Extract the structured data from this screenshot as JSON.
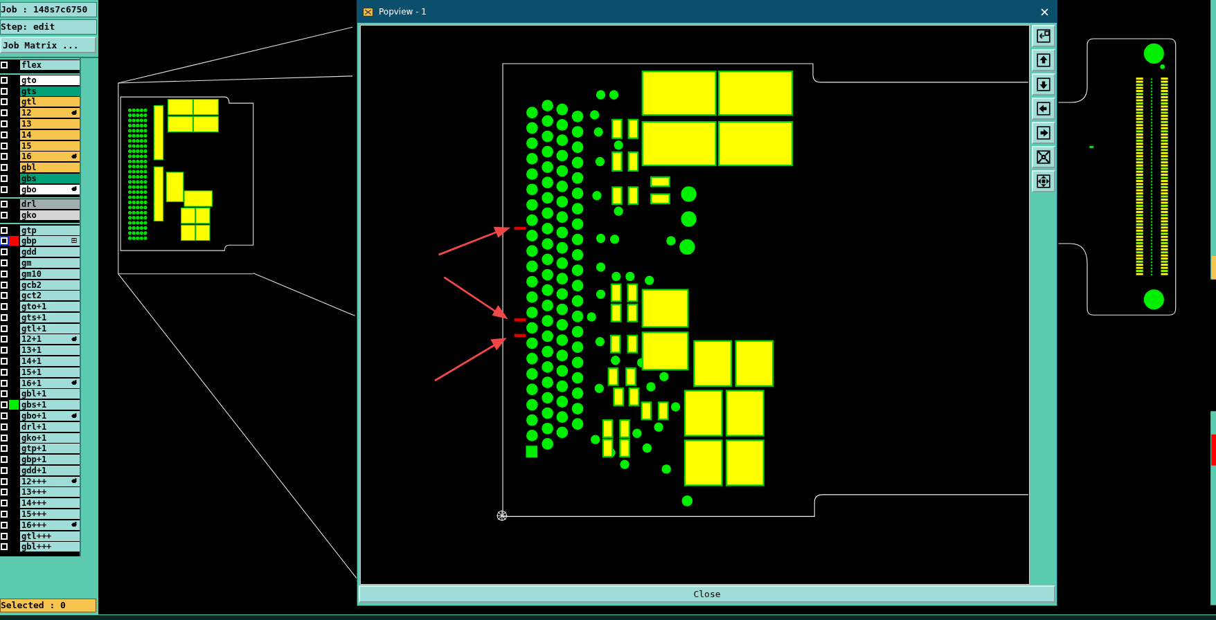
{
  "job_panel": {
    "job_label": "Job : 148s7c6750",
    "step_label": "Step: edit",
    "matrix_button": "Job Matrix ...",
    "layer_groups": [
      {
        "layers": [
          {
            "name": "flex",
            "kind": "misc",
            "checked": false,
            "focused": false,
            "affected": false,
            "work": false
          }
        ]
      },
      {
        "layers": [
          {
            "name": "gto",
            "kind": "silk",
            "checked": false,
            "focused": false,
            "affected": false,
            "work": false
          },
          {
            "name": "gts",
            "kind": "mask",
            "checked": false,
            "focused": false,
            "affected": false,
            "work": false
          },
          {
            "name": "gtl",
            "kind": "signal",
            "checked": false,
            "focused": false,
            "affected": false,
            "work": false
          },
          {
            "name": "12",
            "kind": "signal",
            "checked": false,
            "focused": false,
            "affected": true,
            "work": false
          },
          {
            "name": "13",
            "kind": "signal",
            "checked": false,
            "focused": false,
            "affected": false,
            "work": false
          },
          {
            "name": "14",
            "kind": "signal",
            "checked": false,
            "focused": false,
            "affected": false,
            "work": false
          },
          {
            "name": "15",
            "kind": "signal",
            "checked": false,
            "focused": false,
            "affected": false,
            "work": false
          },
          {
            "name": "16",
            "kind": "signal",
            "checked": false,
            "focused": false,
            "affected": true,
            "work": false
          },
          {
            "name": "gbl",
            "kind": "signal",
            "checked": false,
            "focused": false,
            "affected": false,
            "work": false
          },
          {
            "name": "gbs",
            "kind": "mask",
            "checked": false,
            "focused": false,
            "affected": false,
            "work": false
          },
          {
            "name": "gbo",
            "kind": "silk",
            "checked": false,
            "focused": false,
            "affected": true,
            "work": false
          }
        ]
      },
      {
        "layers": [
          {
            "name": "drl",
            "kind": "drill",
            "checked": false,
            "focused": false,
            "affected": false,
            "work": false
          },
          {
            "name": "gko",
            "kind": "rout",
            "checked": false,
            "focused": false,
            "affected": false,
            "work": false
          }
        ]
      },
      {
        "layers": [
          {
            "name": "gtp",
            "kind": "misc",
            "checked": false,
            "focused": false,
            "affected": false,
            "work": false
          },
          {
            "name": "gbp",
            "kind": "misc",
            "checked": false,
            "focused": true,
            "affected": false,
            "work": true,
            "color": "#ff0000"
          },
          {
            "name": "gdd",
            "kind": "misc",
            "checked": false,
            "focused": false,
            "affected": false,
            "work": false
          },
          {
            "name": "gm",
            "kind": "misc",
            "checked": false,
            "focused": false,
            "affected": false,
            "work": false
          },
          {
            "name": "gm10",
            "kind": "misc",
            "checked": false,
            "focused": false,
            "affected": false,
            "work": false
          },
          {
            "name": "gcb2",
            "kind": "misc",
            "checked": false,
            "focused": false,
            "affected": false,
            "work": false
          },
          {
            "name": "gct2",
            "kind": "misc",
            "checked": false,
            "focused": false,
            "affected": false,
            "work": false
          },
          {
            "name": "gto+1",
            "kind": "misc",
            "checked": false,
            "focused": false,
            "affected": false,
            "work": false
          },
          {
            "name": "gts+1",
            "kind": "misc",
            "checked": false,
            "focused": false,
            "affected": false,
            "work": false
          },
          {
            "name": "gtl+1",
            "kind": "misc",
            "checked": false,
            "focused": false,
            "affected": false,
            "work": false
          },
          {
            "name": "12+1",
            "kind": "misc",
            "checked": false,
            "focused": false,
            "affected": true,
            "work": false
          },
          {
            "name": "13+1",
            "kind": "misc",
            "checked": false,
            "focused": false,
            "affected": false,
            "work": false
          },
          {
            "name": "14+1",
            "kind": "misc",
            "checked": false,
            "focused": false,
            "affected": false,
            "work": false
          },
          {
            "name": "15+1",
            "kind": "misc",
            "checked": false,
            "focused": false,
            "affected": false,
            "work": false
          },
          {
            "name": "16+1",
            "kind": "misc",
            "checked": false,
            "focused": false,
            "affected": true,
            "work": false
          },
          {
            "name": "gbl+1",
            "kind": "misc",
            "checked": false,
            "focused": false,
            "affected": false,
            "work": false
          },
          {
            "name": "gbs+1",
            "kind": "misc",
            "checked": false,
            "focused": false,
            "affected": false,
            "work": false,
            "color": "#00ee00"
          },
          {
            "name": "gbo+1",
            "kind": "misc",
            "checked": false,
            "focused": false,
            "affected": true,
            "work": false
          },
          {
            "name": "drl+1",
            "kind": "misc",
            "checked": false,
            "focused": false,
            "affected": false,
            "work": false
          },
          {
            "name": "gko+1",
            "kind": "misc",
            "checked": false,
            "focused": false,
            "affected": false,
            "work": false
          },
          {
            "name": "gtp+1",
            "kind": "misc",
            "checked": false,
            "focused": false,
            "affected": false,
            "work": false
          },
          {
            "name": "gbp+1",
            "kind": "misc",
            "checked": false,
            "focused": false,
            "affected": false,
            "work": false
          },
          {
            "name": "gdd+1",
            "kind": "misc",
            "checked": false,
            "focused": false,
            "affected": false,
            "work": false
          },
          {
            "name": "12+++",
            "kind": "misc",
            "checked": false,
            "focused": false,
            "affected": true,
            "work": false
          },
          {
            "name": "13+++",
            "kind": "misc",
            "checked": false,
            "focused": false,
            "affected": false,
            "work": false
          },
          {
            "name": "14+++",
            "kind": "misc",
            "checked": false,
            "focused": false,
            "affected": false,
            "work": false
          },
          {
            "name": "15+++",
            "kind": "misc",
            "checked": false,
            "focused": false,
            "affected": false,
            "work": false
          },
          {
            "name": "16+++",
            "kind": "misc",
            "checked": false,
            "focused": false,
            "affected": true,
            "work": false
          },
          {
            "name": "gtl+++",
            "kind": "misc",
            "checked": false,
            "focused": false,
            "affected": false,
            "work": false
          },
          {
            "name": "gbl+++",
            "kind": "misc",
            "checked": false,
            "focused": false,
            "affected": false,
            "work": false
          }
        ]
      }
    ],
    "status": "Selected : 0"
  },
  "popview": {
    "title": "Popview - 1",
    "close_button": "Close"
  }
}
